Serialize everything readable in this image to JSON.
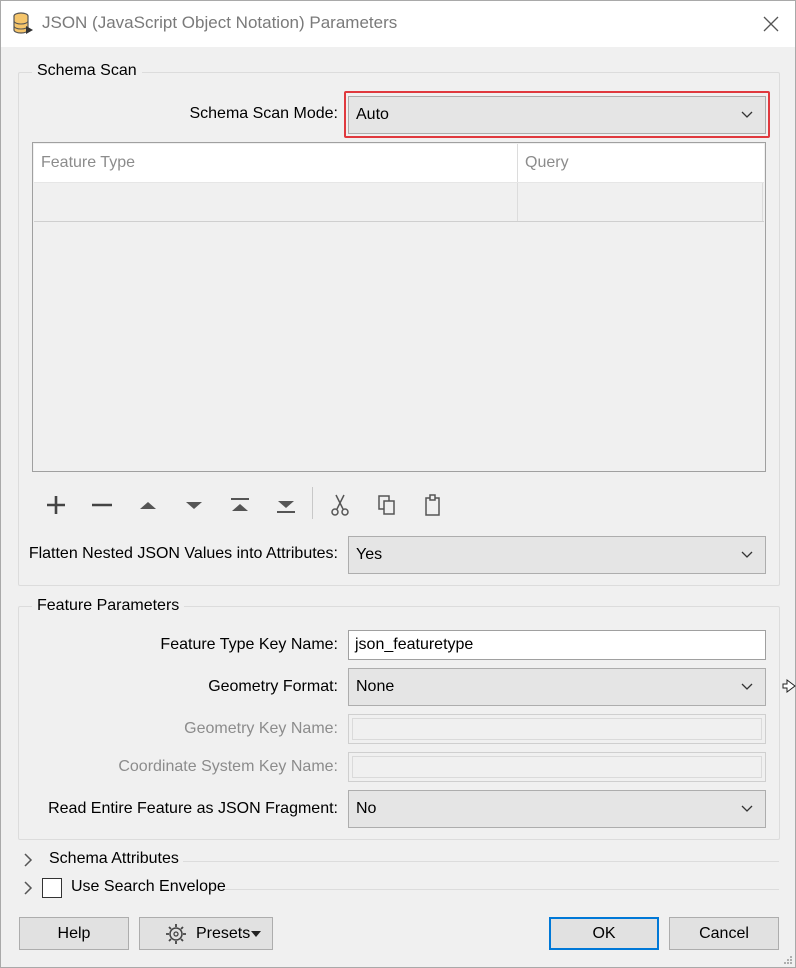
{
  "window": {
    "title": "JSON (JavaScript Object Notation) Parameters"
  },
  "schema_scan": {
    "group_title": "Schema Scan",
    "mode_label": "Schema Scan Mode:",
    "mode_value": "Auto",
    "table": {
      "columns": [
        "Feature Type",
        "Query"
      ],
      "rows": [
        [
          "",
          ""
        ]
      ]
    },
    "toolbar": [
      "add-icon",
      "remove-icon",
      "move-up-icon",
      "move-down-icon",
      "move-to-top-icon",
      "move-to-bottom-icon",
      "cut-icon",
      "copy-icon",
      "paste-icon"
    ],
    "flatten_label": "Flatten Nested JSON Values into Attributes:",
    "flatten_value": "Yes"
  },
  "feature_params": {
    "group_title": "Feature Parameters",
    "key_name_label": "Feature Type Key Name:",
    "key_name_value": "json_featuretype",
    "geometry_format_label": "Geometry Format:",
    "geometry_format_value": "None",
    "geometry_key_label": "Geometry Key Name:",
    "geometry_key_value": "",
    "coord_sys_label": "Coordinate System Key Name:",
    "coord_sys_value": "",
    "read_entire_label": "Read Entire Feature as JSON Fragment:",
    "read_entire_value": "No"
  },
  "sections": {
    "schema_attributes": "Schema Attributes",
    "use_search_envelope": "Use Search Envelope",
    "use_search_envelope_checked": false
  },
  "buttons": {
    "help": "Help",
    "presets": "Presets",
    "ok": "OK",
    "cancel": "Cancel"
  },
  "colors": {
    "highlight": "#e0393e",
    "default_button_border": "#0078d7"
  }
}
